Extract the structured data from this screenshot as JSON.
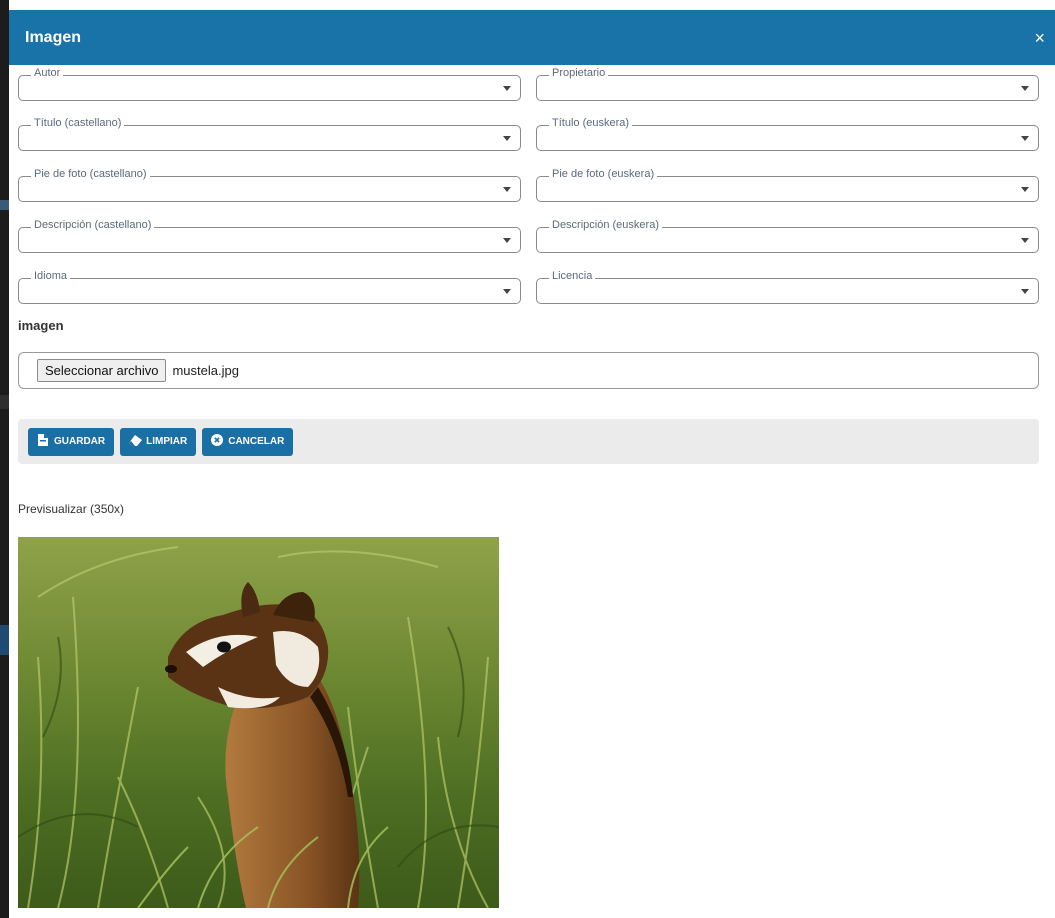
{
  "modal": {
    "title": "Imagen",
    "close_label": "×"
  },
  "fields": [
    {
      "label": "Autor"
    },
    {
      "label": "Propietario"
    },
    {
      "label": "Título (castellano)"
    },
    {
      "label": "Título (euskera)"
    },
    {
      "label": "Pie de foto (castellano)"
    },
    {
      "label": "Pie de foto (euskera)"
    },
    {
      "label": "Descripción (castellano)"
    },
    {
      "label": "Descripción (euskera)"
    },
    {
      "label": "Idioma"
    },
    {
      "label": "Licencia"
    }
  ],
  "image_section": {
    "label": "imagen",
    "file_button": "Seleccionar archivo",
    "file_name": "mustela.jpg"
  },
  "toolbar": {
    "save_label": "GUARDAR",
    "save_icon": "file-save-icon",
    "clear_label": "LIMPIAR",
    "clear_icon": "eraser-icon",
    "cancel_label": "CANCELAR",
    "cancel_icon": "cancel-circle-icon"
  },
  "preview": {
    "label": "Previsualizar (350x)"
  },
  "colors": {
    "header": "#1a73a8",
    "button": "#1a6fa5",
    "toolbar_bg": "#ebebeb"
  }
}
